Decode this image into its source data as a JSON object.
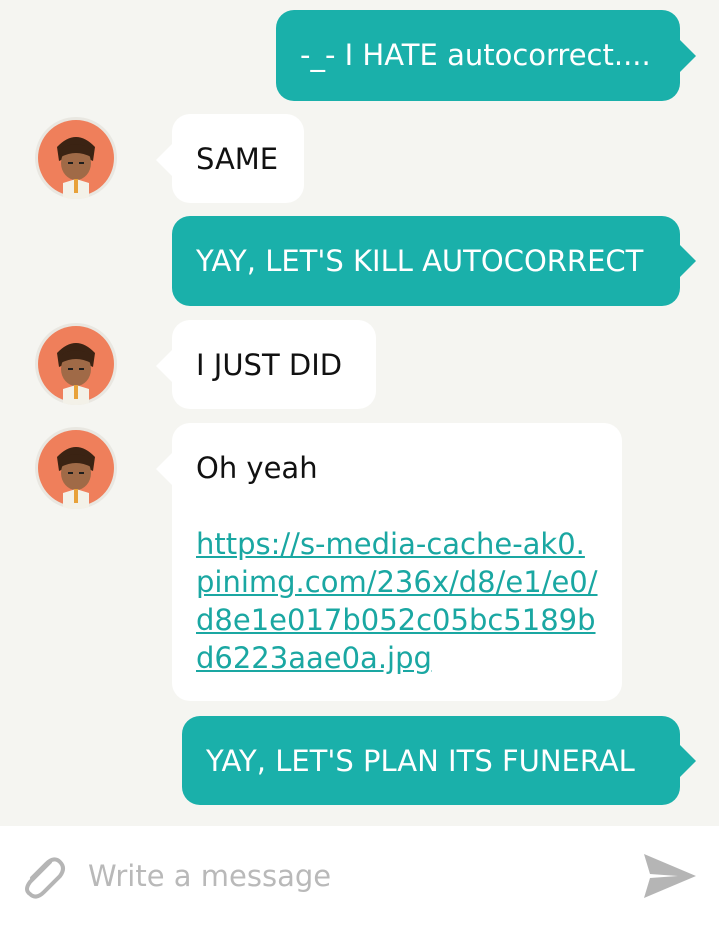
{
  "messages": [
    {
      "direction": "out",
      "text": "-_- I HATE autocorrect...."
    },
    {
      "direction": "in",
      "text": "SAME"
    },
    {
      "direction": "out",
      "text": "YAY, LET'S KILL AUTOCORRECT"
    },
    {
      "direction": "in",
      "text": "I JUST DID"
    },
    {
      "direction": "in",
      "text": "Oh yeah",
      "link": "https://s-media-cache-ak0.pinimg.com/236x/d8/e1/e0/d8e1e017b052c05bc5189bd6223aae0a.jpg"
    },
    {
      "direction": "out",
      "text": "YAY, LET'S PLAN ITS FUNERAL"
    }
  ],
  "composer": {
    "placeholder": "Write a message",
    "value": ""
  },
  "icons": {
    "attach": "paperclip-icon",
    "send": "send-icon"
  },
  "colors": {
    "outgoing_bubble": "#1ab0aa",
    "incoming_bubble": "#ffffff",
    "background": "#f5f5f1",
    "link": "#1aa7a2"
  }
}
